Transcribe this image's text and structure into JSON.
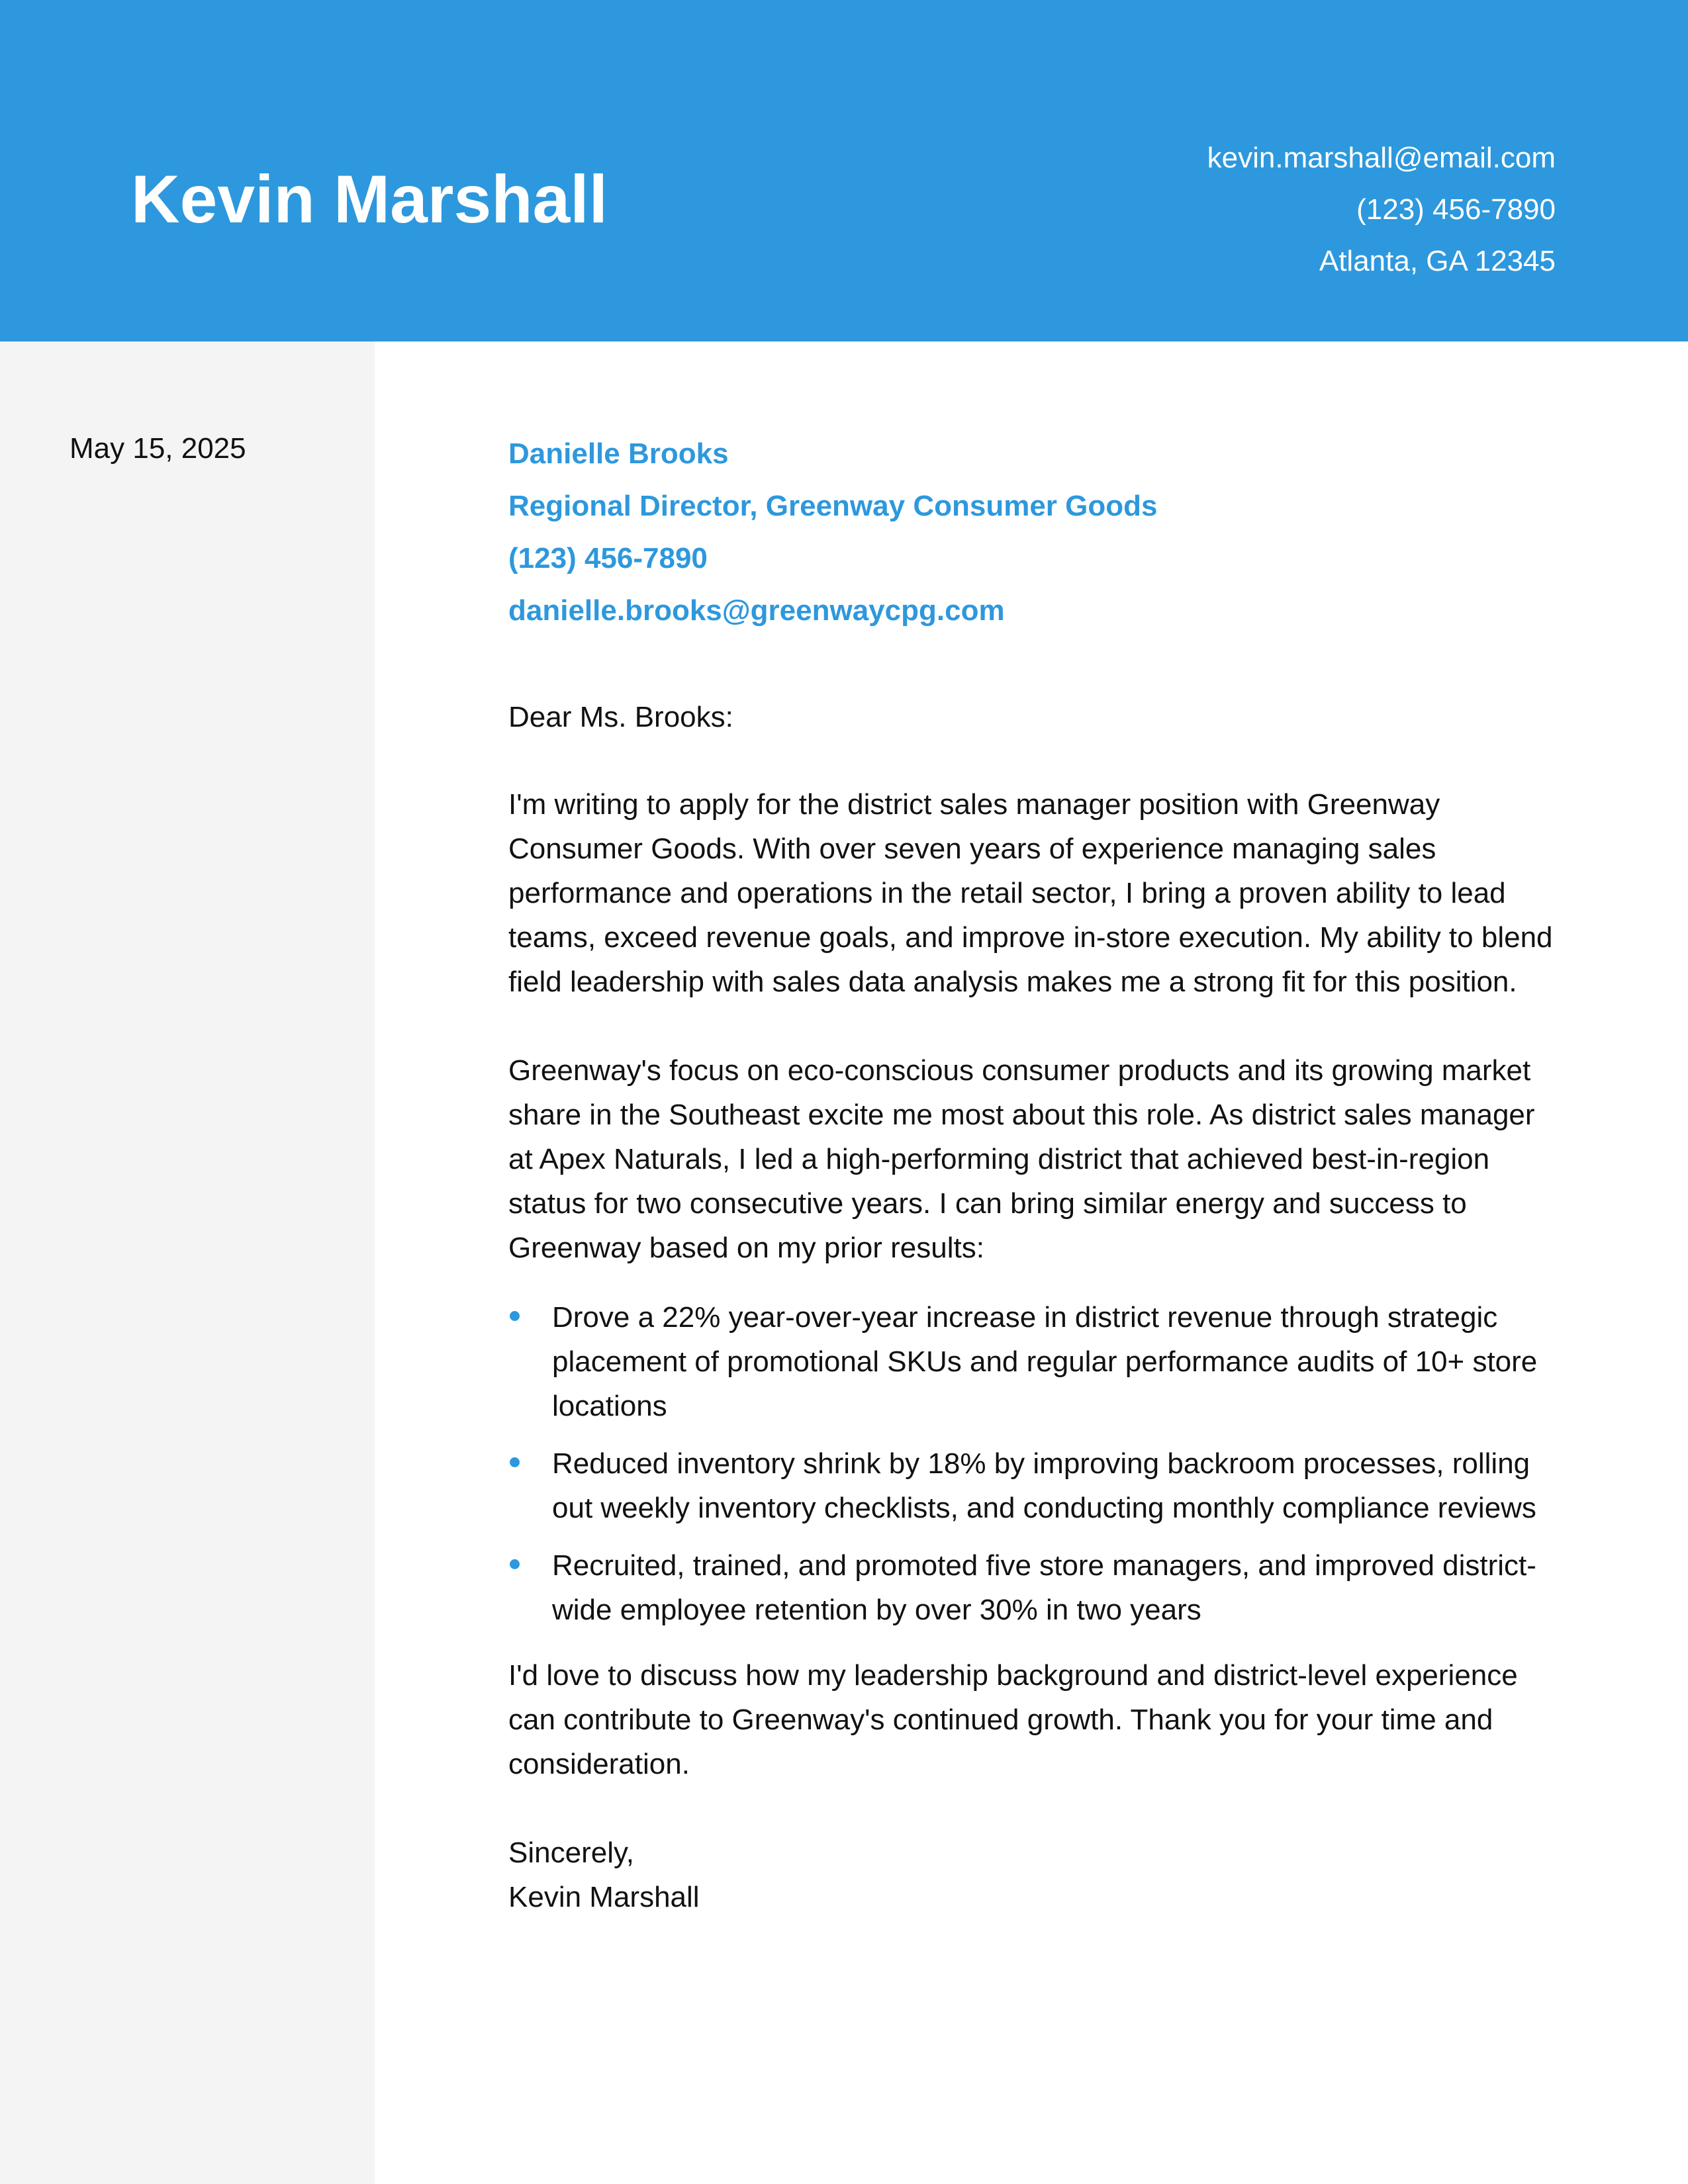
{
  "header": {
    "name": "Kevin Marshall",
    "email": "kevin.marshall@email.com",
    "phone": "(123) 456-7890",
    "location": "Atlanta, GA 12345"
  },
  "date": "May 15, 2025",
  "recipient": {
    "name": "Danielle Brooks",
    "title": "Regional Director, Greenway Consumer Goods",
    "phone": "(123) 456-7890",
    "email": "danielle.brooks@greenwaycpg.com"
  },
  "letter": {
    "greeting": "Dear Ms. Brooks:",
    "paragraph_1": "I'm writing to apply for the district sales manager position with Greenway Consumer Goods. With over seven years of experience managing sales performance and operations in the retail sector, I bring a proven ability to lead teams, exceed revenue goals, and improve in-store execution. My ability to blend field leadership with sales data analysis makes me a strong fit for this position.",
    "paragraph_2": "Greenway's focus on eco-conscious consumer products and its growing market share in the Southeast excite me most about this role. As district sales manager at Apex Naturals, I led a high-performing district that achieved best-in-region status for two consecutive years. I can bring similar energy and success to Greenway based on my prior results:",
    "bullets": [
      "Drove a 22% year-over-year increase in district revenue through strategic placement of promotional SKUs and regular performance audits of 10+ store locations",
      "Reduced inventory shrink by 18% by improving backroom processes, rolling out weekly inventory checklists, and conducting monthly compliance reviews",
      "Recruited, trained, and promoted five store managers, and improved district-wide employee retention by over 30% in two years"
    ],
    "paragraph_3": "I'd love to discuss how my leadership background and district-level experience can contribute to Greenway's continued growth. Thank you for your time and consideration.",
    "closing": "Sincerely,",
    "signature": "Kevin Marshall"
  },
  "colors": {
    "accent": "#2d98dd",
    "sidebar": "#f4f4f4",
    "text": "#111111"
  }
}
